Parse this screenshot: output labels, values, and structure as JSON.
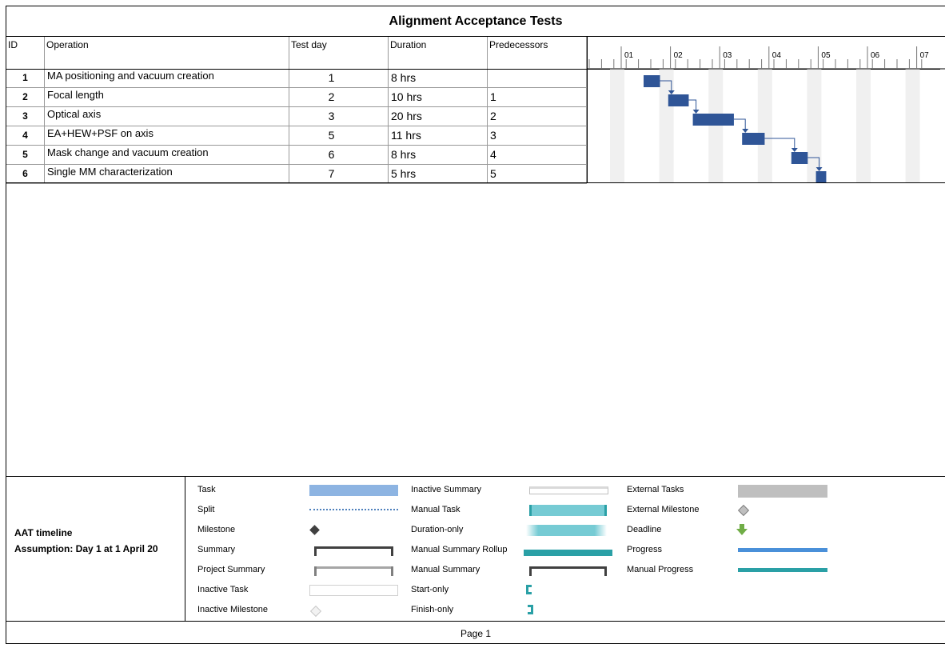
{
  "title": "Alignment Acceptance Tests",
  "columns": {
    "id": "ID",
    "operation": "Operation",
    "test_day": "Test day",
    "duration": "Duration",
    "predecessors": "Predecessors"
  },
  "tasks": [
    {
      "id": "1",
      "operation": "MA positioning and vacuum creation",
      "test_day": "1",
      "duration": "8 hrs",
      "predecessors": ""
    },
    {
      "id": "2",
      "operation": "Focal length",
      "test_day": "2",
      "duration": "10 hrs",
      "predecessors": "1"
    },
    {
      "id": "3",
      "operation": "Optical axis",
      "test_day": "3",
      "duration": "20 hrs",
      "predecessors": "2"
    },
    {
      "id": "4",
      "operation": "EA+HEW+PSF on axis",
      "test_day": "5",
      "duration": "11 hrs",
      "predecessors": "3"
    },
    {
      "id": "5",
      "operation": "Mask change and vacuum creation",
      "test_day": "6",
      "duration": "8 hrs",
      "predecessors": "4"
    },
    {
      "id": "6",
      "operation": "Single MM characterization",
      "test_day": "7",
      "duration": "5 hrs",
      "predecessors": "5"
    }
  ],
  "timeline": {
    "ticks": [
      "01",
      "02",
      "03",
      "04",
      "05",
      "06",
      "07"
    ],
    "bar_color": "#2f5597"
  },
  "legend": {
    "note_line1": "AAT timeline",
    "note_line2": "Assumption: Day 1 at 1 April 20",
    "col1": [
      "Task",
      "Split",
      "Milestone",
      "Summary",
      "Project Summary",
      "Inactive Task",
      "Inactive Milestone"
    ],
    "col2": [
      "Inactive Summary",
      "Manual Task",
      "Duration-only",
      "Manual Summary Rollup",
      "Manual Summary",
      "Start-only",
      "Finish-only"
    ],
    "col3": [
      "External Tasks",
      "External Milestone",
      "Deadline",
      "Progress",
      "Manual Progress"
    ]
  },
  "footer": "Page 1"
}
